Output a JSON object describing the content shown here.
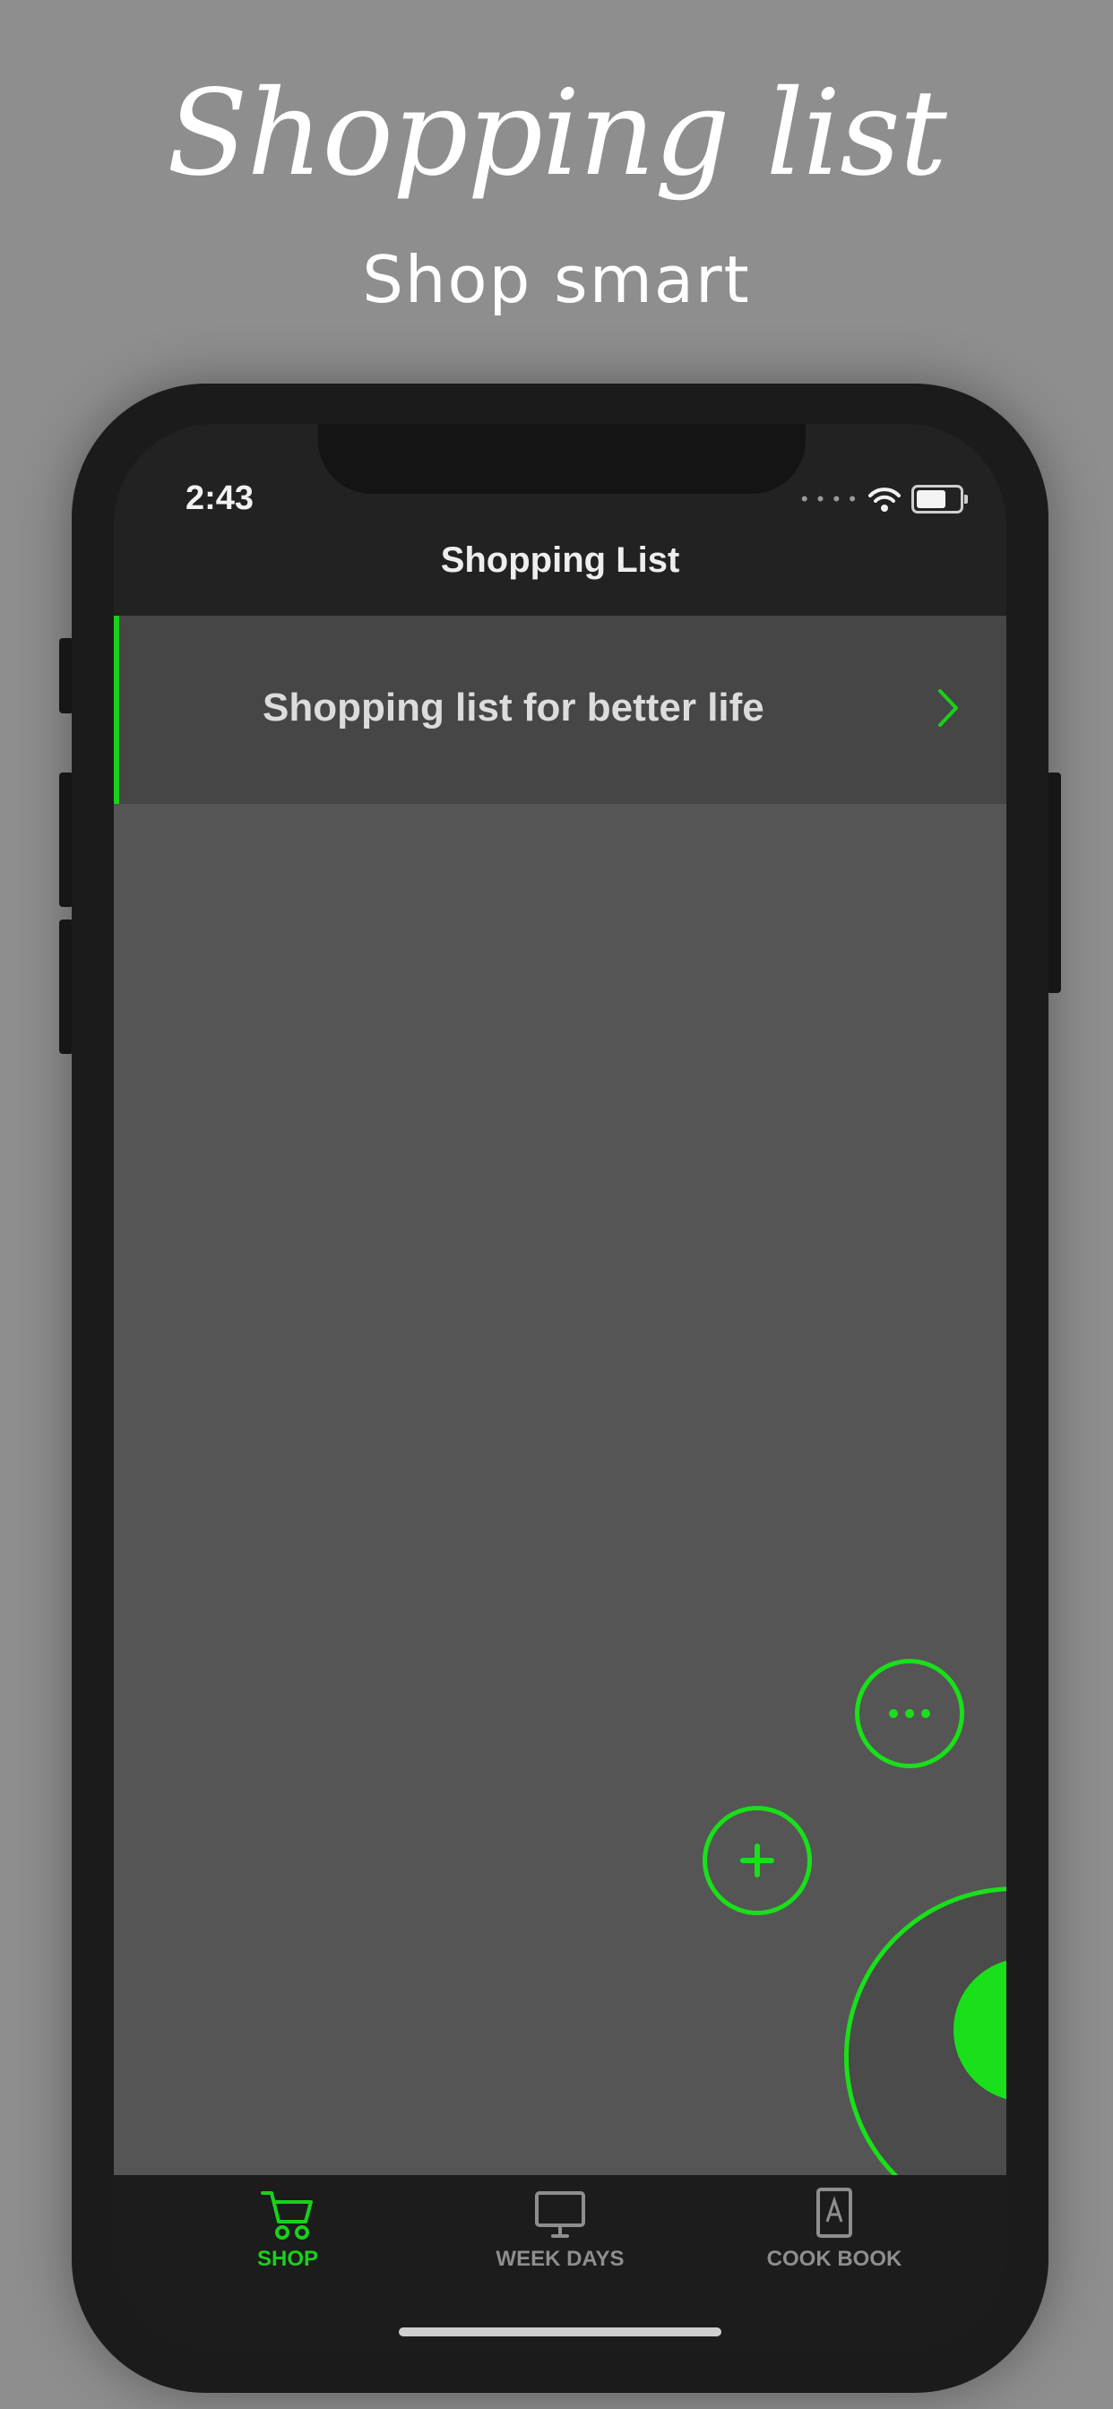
{
  "hero": {
    "title": "Shopping list",
    "subtitle": "Shop smart"
  },
  "status_bar": {
    "time": "2:43",
    "icons": [
      "signal-icon",
      "wifi-icon",
      "battery-icon"
    ]
  },
  "nav": {
    "title": "Shopping List"
  },
  "list": {
    "items": [
      {
        "label": "Shopping list for better life",
        "icon": "chevron-right-icon"
      }
    ]
  },
  "fab": {
    "more_icon": "more-horizontal-icon",
    "add_icon": "plus-icon"
  },
  "tabbar": {
    "tabs": [
      {
        "label": "SHOP",
        "icon": "cart-icon",
        "active": true
      },
      {
        "label": "WEEK DAYS",
        "icon": "monitor-icon",
        "active": false
      },
      {
        "label": "COOK BOOK",
        "icon": "book-icon",
        "active": false
      }
    ]
  },
  "colors": {
    "accent": "#19d11a",
    "background": "#8e8e8e",
    "screen_background": "#555555"
  }
}
